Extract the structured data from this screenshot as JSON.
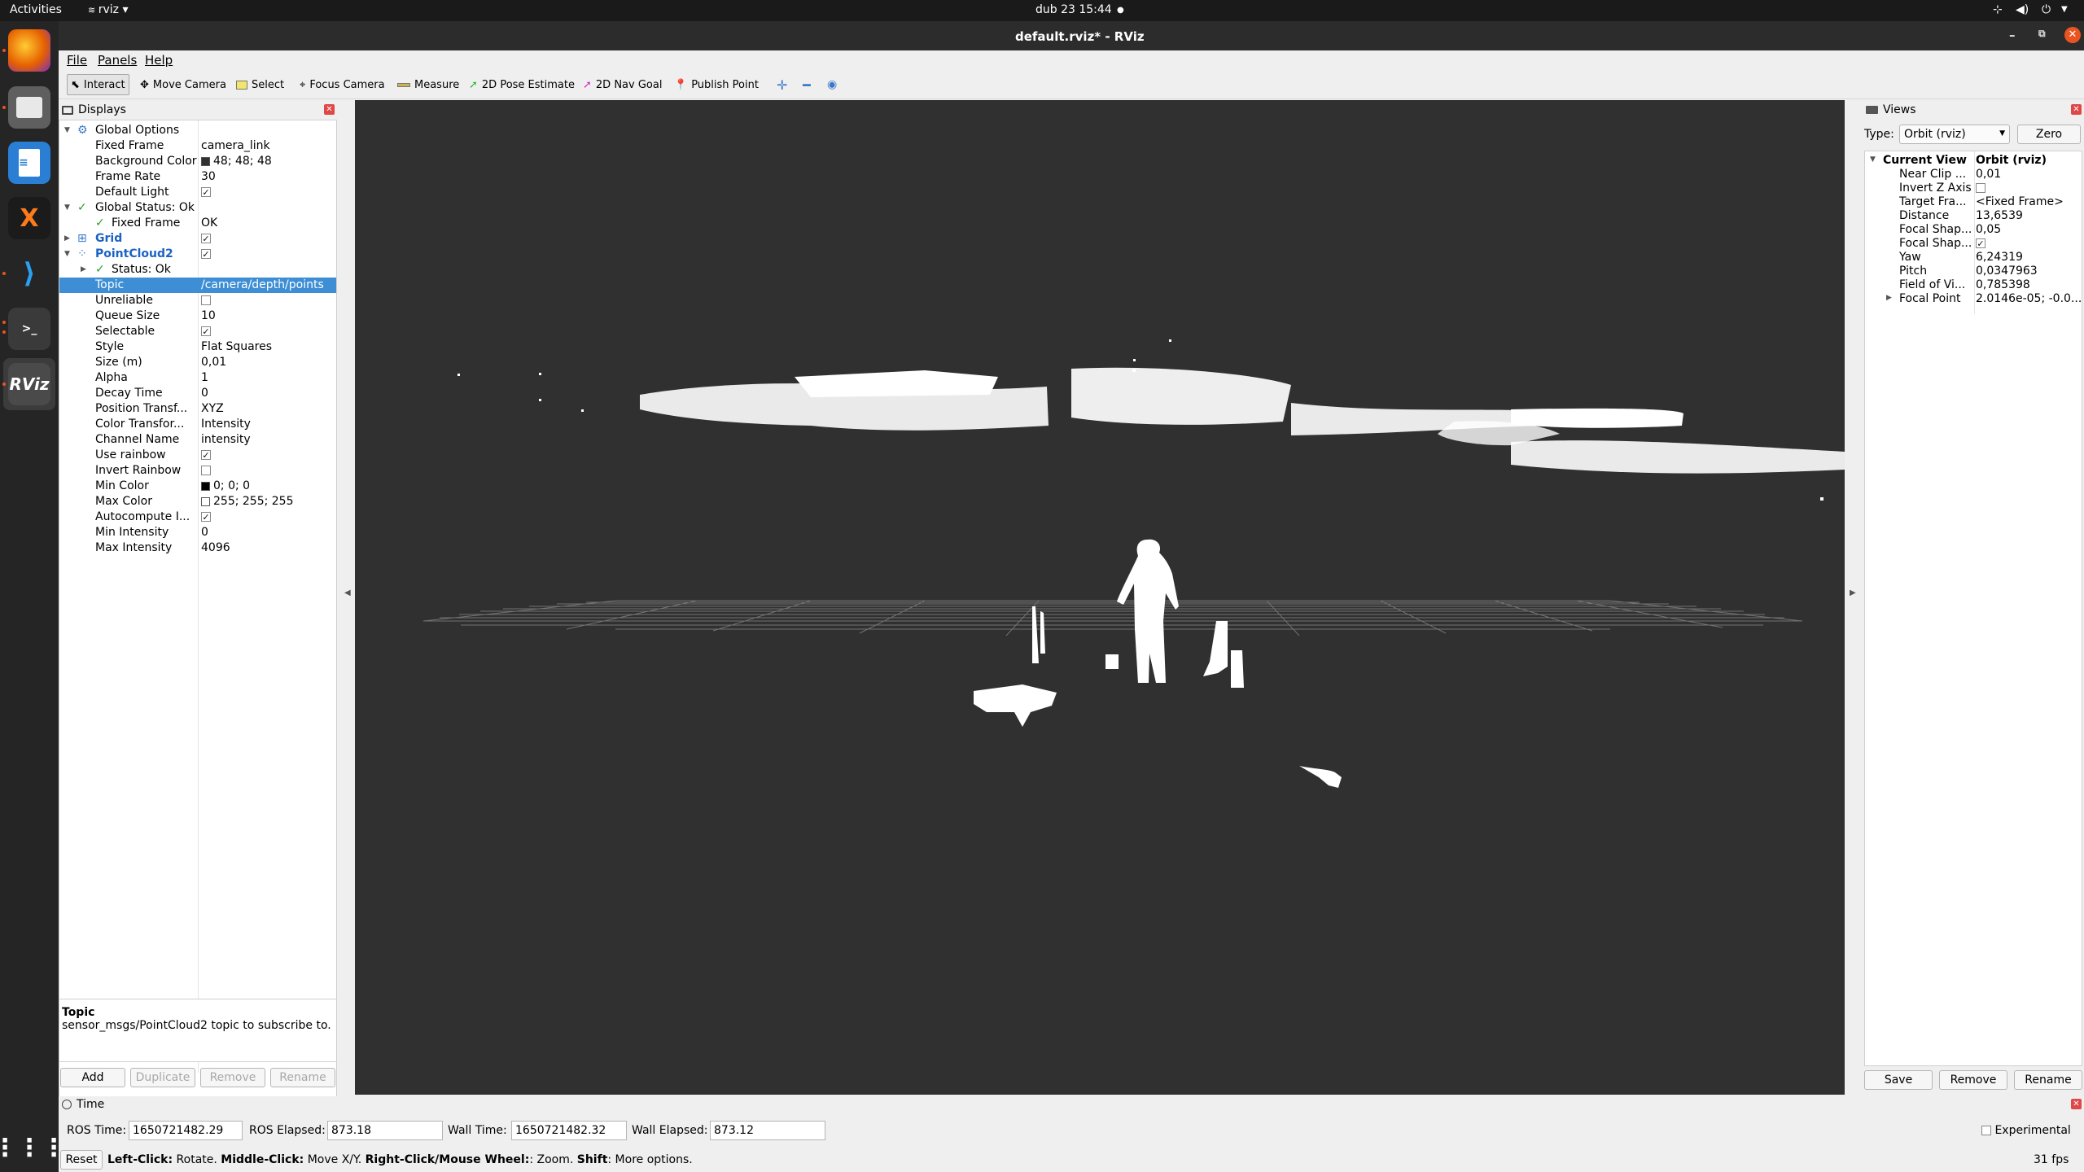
{
  "system": {
    "activities": "Activities",
    "app_menu": "rviz",
    "clock": "dub 23  15:44"
  },
  "window": {
    "title": "default.rviz* - RViz"
  },
  "menu": [
    "File",
    "Panels",
    "Help"
  ],
  "toolbar": {
    "interact": "Interact",
    "move_camera": "Move Camera",
    "select": "Select",
    "focus_camera": "Focus Camera",
    "measure": "Measure",
    "pose_estimate": "2D Pose Estimate",
    "nav_goal": "2D Nav Goal",
    "publish_point": "Publish Point"
  },
  "displays": {
    "title": "Displays",
    "rows": [
      {
        "name": "Global Options",
        "value": ""
      },
      {
        "name": "Fixed Frame",
        "value": "camera_link"
      },
      {
        "name": "Background Color",
        "value": "48; 48; 48"
      },
      {
        "name": "Frame Rate",
        "value": "30"
      },
      {
        "name": "Default Light",
        "value": ""
      },
      {
        "name": "Global Status: Ok",
        "value": ""
      },
      {
        "name": "Fixed Frame",
        "value": "OK"
      },
      {
        "name": "Grid",
        "value": ""
      },
      {
        "name": "PointCloud2",
        "value": ""
      },
      {
        "name": "Status: Ok",
        "value": ""
      },
      {
        "name": "Topic",
        "value": "/camera/depth/points"
      },
      {
        "name": "Unreliable",
        "value": ""
      },
      {
        "name": "Queue Size",
        "value": "10"
      },
      {
        "name": "Selectable",
        "value": ""
      },
      {
        "name": "Style",
        "value": "Flat Squares"
      },
      {
        "name": "Size (m)",
        "value": "0,01"
      },
      {
        "name": "Alpha",
        "value": "1"
      },
      {
        "name": "Decay Time",
        "value": "0"
      },
      {
        "name": "Position Transf...",
        "value": "XYZ"
      },
      {
        "name": "Color Transfor...",
        "value": "Intensity"
      },
      {
        "name": "Channel Name",
        "value": "intensity"
      },
      {
        "name": "Use rainbow",
        "value": ""
      },
      {
        "name": "Invert Rainbow",
        "value": ""
      },
      {
        "name": "Min Color",
        "value": "0; 0; 0"
      },
      {
        "name": "Max Color",
        "value": "255; 255; 255"
      },
      {
        "name": "Autocompute I...",
        "value": ""
      },
      {
        "name": "Min Intensity",
        "value": "0"
      },
      {
        "name": "Max Intensity",
        "value": "4096"
      }
    ],
    "help_title": "Topic",
    "help_text": "sensor_msgs/PointCloud2 topic to subscribe to.",
    "buttons": {
      "add": "Add",
      "duplicate": "Duplicate",
      "remove": "Remove",
      "rename": "Rename"
    }
  },
  "views": {
    "title": "Views",
    "type_label": "Type:",
    "type_value": "Orbit (rviz)",
    "zero": "Zero",
    "rows": [
      {
        "name": "Current View",
        "value": "Orbit (rviz)"
      },
      {
        "name": "Near Clip ...",
        "value": "0,01"
      },
      {
        "name": "Invert Z Axis",
        "value": ""
      },
      {
        "name": "Target Fra...",
        "value": "<Fixed Frame>"
      },
      {
        "name": "Distance",
        "value": "13,6539"
      },
      {
        "name": "Focal Shap...",
        "value": "0,05"
      },
      {
        "name": "Focal Shap...",
        "value": ""
      },
      {
        "name": "Yaw",
        "value": "6,24319"
      },
      {
        "name": "Pitch",
        "value": "0,0347963"
      },
      {
        "name": "Field of Vi...",
        "value": "0,785398"
      },
      {
        "name": "Focal Point",
        "value": "2.0146e-05; -0.0..."
      }
    ],
    "buttons": {
      "save": "Save",
      "remove": "Remove",
      "rename": "Rename"
    }
  },
  "time": {
    "title": "Time",
    "ros_time_label": "ROS Time:",
    "ros_time": "1650721482.29",
    "ros_elapsed_label": "ROS Elapsed:",
    "ros_elapsed": "873.18",
    "wall_time_label": "Wall Time:",
    "wall_time": "1650721482.32",
    "wall_elapsed_label": "Wall Elapsed:",
    "wall_elapsed": "873.12",
    "experimental": "Experimental"
  },
  "status": {
    "reset": "Reset",
    "k1": "Left-Click:",
    "v1": " Rotate. ",
    "k2": "Middle-Click:",
    "v2": " Move X/Y. ",
    "k3": "Right-Click/Mouse Wheel:",
    "v3": ": Zoom. ",
    "k4": "Shift",
    "v4": ": More options.",
    "fps": "31 fps"
  }
}
